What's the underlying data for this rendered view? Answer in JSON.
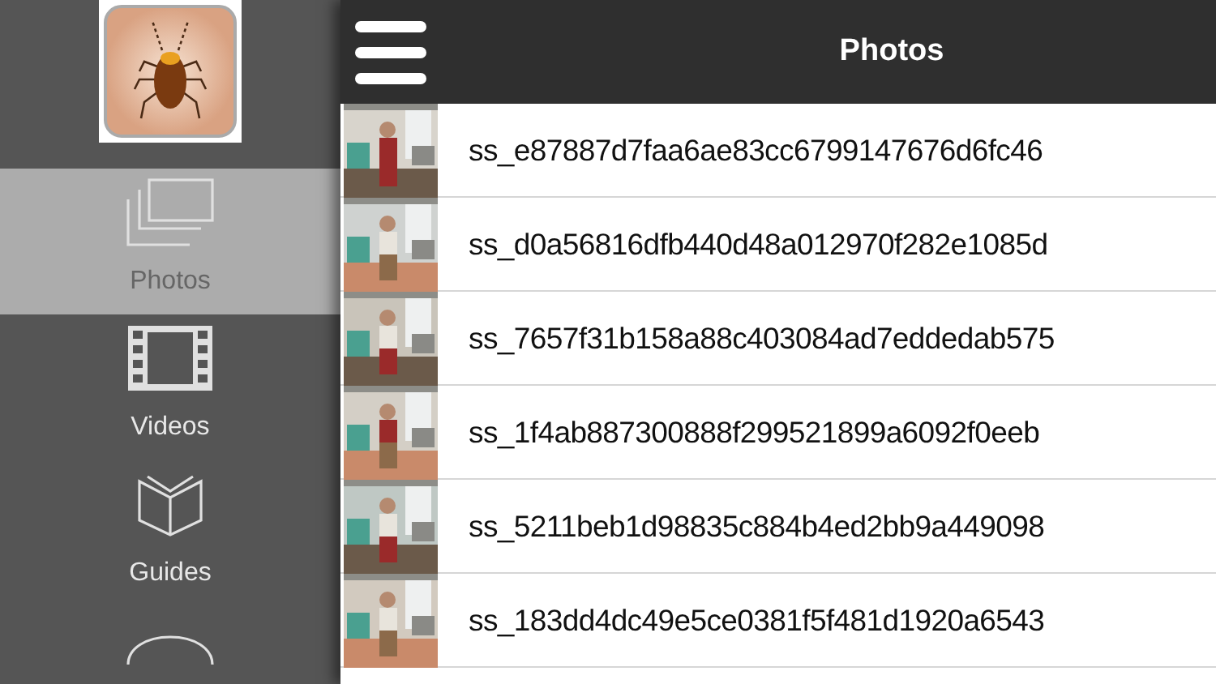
{
  "header": {
    "title": "Photos"
  },
  "sidebar": {
    "items": [
      {
        "label": "Photos",
        "kind": "photos",
        "selected": true
      },
      {
        "label": "Videos",
        "kind": "videos",
        "selected": false
      },
      {
        "label": "Guides",
        "kind": "guides",
        "selected": false
      },
      {
        "kind": "chat",
        "selected": false
      }
    ]
  },
  "photos": [
    {
      "name": "ss_e87887d7faa6ae83cc6799147676d6fc46"
    },
    {
      "name": "ss_d0a56816dfb440d48a012970f282e1085d"
    },
    {
      "name": "ss_7657f31b158a88c403084ad7eddedab575"
    },
    {
      "name": "ss_1f4ab887300888f299521899a6092f0eeb"
    },
    {
      "name": "ss_5211beb1d98835c884b4ed2bb9a449098"
    },
    {
      "name": "ss_183dd4dc49e5ce0381f5f481d1920a6543"
    }
  ]
}
